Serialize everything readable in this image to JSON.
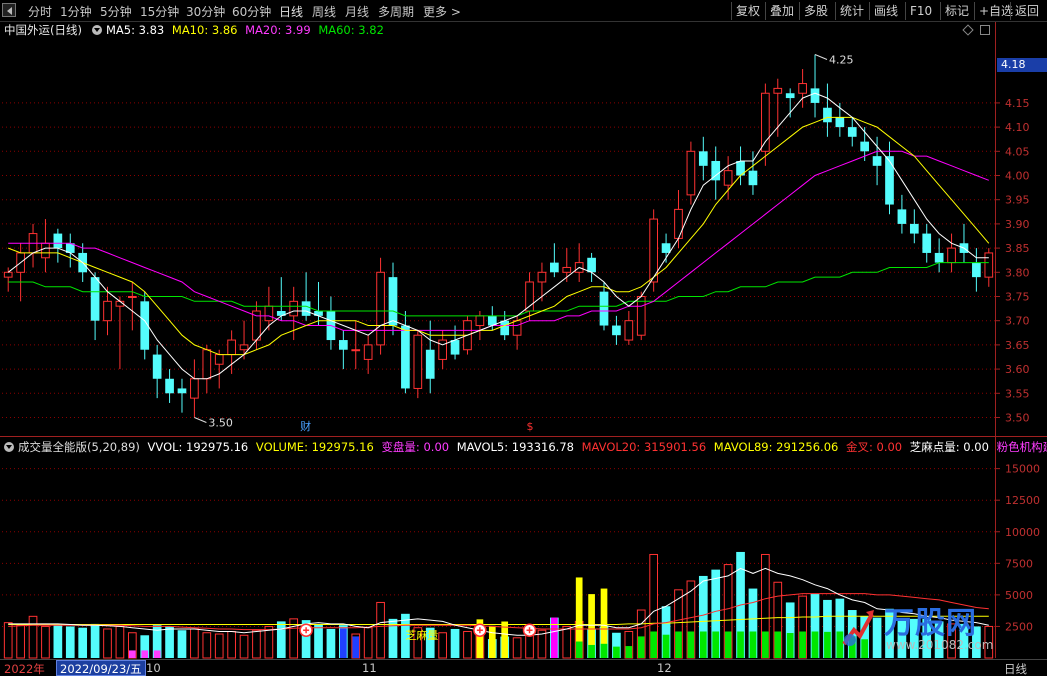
{
  "toolbar": {
    "left_items": [
      "分时",
      "1分钟",
      "5分钟",
      "15分钟",
      "30分钟",
      "60分钟",
      "日线",
      "周线",
      "月线",
      "多周期",
      "更多"
    ],
    "more_arrow": ">",
    "active_item": "日线",
    "right_items": [
      "复权",
      "叠加",
      "多股",
      "统计",
      "画线",
      "F10",
      "标记",
      "+自选",
      "返回"
    ]
  },
  "price_panel": {
    "stock_name": "中国外运(日线)",
    "ma5_label": "MA5: 3.83",
    "ma10_label": "MA10: 3.86",
    "ma20_label": "MA20: 3.99",
    "ma60_label": "MA60: 3.82",
    "current_price_tag": "4.18",
    "high_marker": "4.25",
    "low_marker": "3.50",
    "event_marker_cai": "财",
    "event_marker_dollar": "$",
    "colors": {
      "up": "#ff3232",
      "down": "#54fcfc",
      "ma5": "#ffffff",
      "ma10": "#ffff00",
      "ma20": "#ff00ff",
      "ma60": "#00e600"
    }
  },
  "volume_panel": {
    "indicator_name": "成交量全能版(5,20,89)",
    "vvol": "VVOL: 192975.16",
    "volume": "VOLUME: 192975.16",
    "bianpan": "变盘量: 0.00",
    "mavol5": "MAVOL5: 193316.78",
    "mavol20": "MAVOL20: 315901.56",
    "mavol89": "MAVOL89: 291256.06",
    "jincha": "金叉: 0.00",
    "zhima": "芝麻点量: 0.00",
    "fense": "粉色机构建",
    "inline_annotation": "芝麻量"
  },
  "date_bar": {
    "year": "2022年",
    "current_date": "2022/09/23/五",
    "months": [
      "10",
      "11",
      "12"
    ],
    "period": "日线"
  },
  "watermark": {
    "text": "万股网",
    "url": "www.201082.com"
  },
  "chart_data": [
    {
      "type": "candlestick",
      "title": "中国外运(日线)",
      "y_ticks": [
        3.5,
        3.55,
        3.6,
        3.65,
        3.7,
        3.75,
        3.8,
        3.85,
        3.9,
        3.95,
        4.0,
        4.05,
        4.1,
        4.15
      ],
      "ylim": [
        3.47,
        4.28
      ],
      "candles": [
        [
          3.79,
          3.81,
          3.76,
          3.8
        ],
        [
          3.8,
          3.86,
          3.74,
          3.84
        ],
        [
          3.84,
          3.9,
          3.81,
          3.88
        ],
        [
          3.83,
          3.91,
          3.8,
          3.86
        ],
        [
          3.88,
          3.89,
          3.82,
          3.85
        ],
        [
          3.86,
          3.88,
          3.81,
          3.84
        ],
        [
          3.84,
          3.86,
          3.78,
          3.8
        ],
        [
          3.79,
          3.8,
          3.66,
          3.7
        ],
        [
          3.7,
          3.77,
          3.67,
          3.74
        ],
        [
          3.73,
          3.75,
          3.6,
          3.74
        ],
        [
          3.75,
          3.78,
          3.68,
          3.75
        ],
        [
          3.74,
          3.76,
          3.62,
          3.64
        ],
        [
          3.63,
          3.65,
          3.54,
          3.58
        ],
        [
          3.58,
          3.6,
          3.53,
          3.55
        ],
        [
          3.56,
          3.58,
          3.51,
          3.55
        ],
        [
          3.54,
          3.62,
          3.5,
          3.58
        ],
        [
          3.58,
          3.65,
          3.55,
          3.64
        ],
        [
          3.61,
          3.64,
          3.56,
          3.63
        ],
        [
          3.63,
          3.68,
          3.59,
          3.66
        ],
        [
          3.64,
          3.7,
          3.62,
          3.65
        ],
        [
          3.66,
          3.74,
          3.64,
          3.72
        ],
        [
          3.7,
          3.77,
          3.68,
          3.73
        ],
        [
          3.72,
          3.79,
          3.7,
          3.71
        ],
        [
          3.71,
          3.77,
          3.66,
          3.74
        ],
        [
          3.74,
          3.8,
          3.7,
          3.71
        ],
        [
          3.72,
          3.78,
          3.69,
          3.71
        ],
        [
          3.72,
          3.75,
          3.64,
          3.66
        ],
        [
          3.66,
          3.68,
          3.6,
          3.64
        ],
        [
          3.64,
          3.7,
          3.6,
          3.64
        ],
        [
          3.62,
          3.67,
          3.59,
          3.65
        ],
        [
          3.65,
          3.83,
          3.63,
          3.8
        ],
        [
          3.79,
          3.82,
          3.67,
          3.69
        ],
        [
          3.69,
          3.72,
          3.55,
          3.56
        ],
        [
          3.56,
          3.68,
          3.54,
          3.67
        ],
        [
          3.64,
          3.7,
          3.55,
          3.58
        ],
        [
          3.62,
          3.68,
          3.6,
          3.66
        ],
        [
          3.66,
          3.69,
          3.62,
          3.63
        ],
        [
          3.64,
          3.71,
          3.63,
          3.7
        ],
        [
          3.69,
          3.72,
          3.66,
          3.71
        ],
        [
          3.71,
          3.73,
          3.68,
          3.69
        ],
        [
          3.7,
          3.72,
          3.66,
          3.67
        ],
        [
          3.67,
          3.71,
          3.64,
          3.7
        ],
        [
          3.72,
          3.8,
          3.7,
          3.78
        ],
        [
          3.78,
          3.82,
          3.74,
          3.8
        ],
        [
          3.82,
          3.86,
          3.79,
          3.8
        ],
        [
          3.8,
          3.85,
          3.78,
          3.81
        ],
        [
          3.8,
          3.86,
          3.78,
          3.82
        ],
        [
          3.83,
          3.84,
          3.78,
          3.8
        ],
        [
          3.76,
          3.78,
          3.68,
          3.69
        ],
        [
          3.69,
          3.71,
          3.65,
          3.67
        ],
        [
          3.66,
          3.72,
          3.65,
          3.7
        ],
        [
          3.67,
          3.76,
          3.66,
          3.75
        ],
        [
          3.78,
          3.93,
          3.76,
          3.91
        ],
        [
          3.86,
          3.88,
          3.82,
          3.84
        ],
        [
          3.87,
          3.97,
          3.85,
          3.93
        ],
        [
          3.96,
          4.07,
          3.94,
          4.05
        ],
        [
          4.05,
          4.08,
          3.99,
          4.02
        ],
        [
          4.03,
          4.06,
          3.95,
          3.99
        ],
        [
          3.98,
          4.04,
          3.95,
          4.01
        ],
        [
          4.03,
          4.06,
          3.98,
          4.0
        ],
        [
          4.01,
          4.05,
          3.96,
          3.98
        ],
        [
          4.05,
          4.19,
          4.02,
          4.17
        ],
        [
          4.17,
          4.2,
          4.08,
          4.18
        ],
        [
          4.17,
          4.18,
          4.12,
          4.16
        ],
        [
          4.17,
          4.22,
          4.14,
          4.19
        ],
        [
          4.18,
          4.25,
          4.12,
          4.15
        ],
        [
          4.14,
          4.19,
          4.08,
          4.11
        ],
        [
          4.12,
          4.15,
          4.08,
          4.1
        ],
        [
          4.1,
          4.12,
          4.06,
          4.08
        ],
        [
          4.07,
          4.1,
          4.03,
          4.05
        ],
        [
          4.04,
          4.08,
          3.98,
          4.02
        ],
        [
          4.04,
          4.07,
          3.92,
          3.94
        ],
        [
          3.93,
          3.96,
          3.88,
          3.9
        ],
        [
          3.9,
          3.93,
          3.86,
          3.88
        ],
        [
          3.88,
          3.9,
          3.82,
          3.84
        ],
        [
          3.84,
          3.87,
          3.8,
          3.82
        ],
        [
          3.82,
          3.88,
          3.8,
          3.85
        ],
        [
          3.86,
          3.9,
          3.82,
          3.84
        ],
        [
          3.82,
          3.85,
          3.76,
          3.79
        ],
        [
          3.79,
          3.85,
          3.77,
          3.84
        ]
      ],
      "ma5": [
        3.8,
        3.82,
        3.84,
        3.85,
        3.85,
        3.84,
        3.82,
        3.79,
        3.76,
        3.74,
        3.72,
        3.7,
        3.66,
        3.63,
        3.6,
        3.58,
        3.58,
        3.59,
        3.61,
        3.63,
        3.66,
        3.69,
        3.71,
        3.72,
        3.72,
        3.71,
        3.7,
        3.69,
        3.68,
        3.67,
        3.69,
        3.7,
        3.69,
        3.68,
        3.66,
        3.65,
        3.66,
        3.67,
        3.68,
        3.69,
        3.7,
        3.71,
        3.73,
        3.75,
        3.77,
        3.79,
        3.81,
        3.8,
        3.78,
        3.75,
        3.73,
        3.75,
        3.79,
        3.83,
        3.87,
        3.93,
        3.98,
        4.0,
        4.02,
        4.03,
        4.03,
        4.07,
        4.1,
        4.13,
        4.16,
        4.17,
        4.16,
        4.14,
        4.12,
        4.09,
        4.06,
        4.03,
        3.99,
        3.95,
        3.91,
        3.88,
        3.86,
        3.85,
        3.83,
        3.83
      ],
      "ma10": [
        3.85,
        3.84,
        3.84,
        3.84,
        3.84,
        3.83,
        3.82,
        3.81,
        3.8,
        3.79,
        3.78,
        3.76,
        3.73,
        3.7,
        3.67,
        3.65,
        3.64,
        3.63,
        3.63,
        3.63,
        3.64,
        3.65,
        3.67,
        3.68,
        3.69,
        3.7,
        3.7,
        3.7,
        3.7,
        3.69,
        3.69,
        3.69,
        3.68,
        3.68,
        3.67,
        3.67,
        3.67,
        3.67,
        3.68,
        3.68,
        3.69,
        3.7,
        3.71,
        3.72,
        3.73,
        3.75,
        3.76,
        3.77,
        3.77,
        3.76,
        3.76,
        3.77,
        3.79,
        3.81,
        3.84,
        3.87,
        3.9,
        3.94,
        3.97,
        4.0,
        4.02,
        4.04,
        4.06,
        4.08,
        4.1,
        4.11,
        4.12,
        4.12,
        4.12,
        4.11,
        4.1,
        4.08,
        4.06,
        4.04,
        4.01,
        3.98,
        3.95,
        3.92,
        3.89,
        3.86
      ],
      "ma20": [
        3.86,
        3.86,
        3.86,
        3.86,
        3.86,
        3.86,
        3.85,
        3.85,
        3.84,
        3.83,
        3.82,
        3.81,
        3.8,
        3.79,
        3.78,
        3.76,
        3.75,
        3.74,
        3.73,
        3.72,
        3.71,
        3.71,
        3.7,
        3.7,
        3.69,
        3.69,
        3.69,
        3.68,
        3.68,
        3.68,
        3.68,
        3.68,
        3.68,
        3.68,
        3.68,
        3.68,
        3.68,
        3.68,
        3.68,
        3.69,
        3.69,
        3.69,
        3.7,
        3.7,
        3.7,
        3.71,
        3.71,
        3.72,
        3.72,
        3.72,
        3.73,
        3.73,
        3.74,
        3.76,
        3.78,
        3.8,
        3.82,
        3.84,
        3.86,
        3.88,
        3.9,
        3.92,
        3.94,
        3.96,
        3.98,
        4.0,
        4.01,
        4.02,
        4.03,
        4.04,
        4.05,
        4.05,
        4.05,
        4.04,
        4.04,
        4.03,
        4.02,
        4.01,
        4.0,
        3.99
      ],
      "ma60": [
        3.78,
        3.78,
        3.78,
        3.77,
        3.77,
        3.77,
        3.76,
        3.76,
        3.76,
        3.76,
        3.76,
        3.75,
        3.75,
        3.75,
        3.75,
        3.74,
        3.74,
        3.74,
        3.74,
        3.73,
        3.73,
        3.73,
        3.73,
        3.73,
        3.73,
        3.72,
        3.72,
        3.72,
        3.72,
        3.72,
        3.72,
        3.72,
        3.71,
        3.71,
        3.71,
        3.71,
        3.71,
        3.71,
        3.71,
        3.71,
        3.71,
        3.71,
        3.72,
        3.72,
        3.72,
        3.72,
        3.73,
        3.73,
        3.73,
        3.73,
        3.74,
        3.74,
        3.74,
        3.74,
        3.75,
        3.75,
        3.75,
        3.76,
        3.76,
        3.77,
        3.77,
        3.77,
        3.78,
        3.78,
        3.78,
        3.79,
        3.79,
        3.79,
        3.8,
        3.8,
        3.8,
        3.81,
        3.81,
        3.81,
        3.81,
        3.82,
        3.82,
        3.82,
        3.82,
        3.82
      ]
    },
    {
      "type": "bar",
      "title": "成交量全能版(5,20,89)",
      "y_ticks": [
        2500,
        5000,
        7500,
        10000,
        12500,
        15000
      ],
      "ylim": [
        0,
        16000
      ],
      "volumes": [
        2800,
        2600,
        3300,
        2500,
        2700,
        2500,
        2400,
        2700,
        2300,
        2500,
        2000,
        1800,
        2600,
        2500,
        2200,
        2300,
        2000,
        1900,
        2100,
        1800,
        2200,
        2500,
        2900,
        3100,
        3000,
        2700,
        2300,
        2600,
        1900,
        2400,
        4400,
        3100,
        3500,
        2400,
        2400,
        2000,
        2300,
        2100,
        1800,
        1500,
        1700,
        1600,
        2200,
        2200,
        3200,
        2500,
        2900,
        2300,
        2500,
        2000,
        2100,
        3800,
        8200,
        4100,
        5400,
        6100,
        6500,
        7000,
        7400,
        8400,
        5500,
        8200,
        6000,
        4400,
        4900,
        5100,
        4600,
        4700,
        3800,
        3300,
        3200,
        3900,
        3000,
        3100,
        3100,
        2900,
        2700,
        2700,
        2500,
        2500
      ],
      "mavol5": [
        2700,
        2700,
        2700,
        2700,
        2700,
        2650,
        2600,
        2600,
        2550,
        2500,
        2400,
        2300,
        2200,
        2300,
        2300,
        2300,
        2200,
        2100,
        2100,
        2000,
        2100,
        2200,
        2300,
        2500,
        2700,
        2800,
        2700,
        2700,
        2500,
        2400,
        2800,
        2900,
        3000,
        3100,
        3000,
        2900,
        2600,
        2400,
        2200,
        2000,
        1900,
        1800,
        1800,
        1900,
        2100,
        2300,
        2600,
        2600,
        2600,
        2400,
        2400,
        2700,
        3700,
        4100,
        4700,
        5300,
        6100,
        6300,
        6500,
        7100,
        6700,
        7100,
        6700,
        6500,
        6200,
        5800,
        5500,
        5000,
        4600,
        4400,
        3900,
        3800,
        3600,
        3500,
        3300,
        3200,
        3000,
        2900,
        2800,
        2600
      ],
      "mavol20": [
        2500,
        2550,
        2600,
        2600,
        2600,
        2600,
        2600,
        2600,
        2600,
        2600,
        2550,
        2500,
        2500,
        2500,
        2450,
        2400,
        2350,
        2300,
        2300,
        2250,
        2250,
        2250,
        2300,
        2350,
        2400,
        2400,
        2400,
        2400,
        2400,
        2450,
        2500,
        2550,
        2600,
        2600,
        2600,
        2600,
        2600,
        2600,
        2550,
        2500,
        2450,
        2400,
        2350,
        2300,
        2300,
        2300,
        2300,
        2300,
        2300,
        2300,
        2300,
        2400,
        2700,
        2800,
        3000,
        3200,
        3400,
        3700,
        3900,
        4200,
        4400,
        4700,
        4900,
        5000,
        5100,
        5100,
        5100,
        5100,
        5100,
        5100,
        5000,
        5000,
        4900,
        4800,
        4700,
        4600,
        4400,
        4200,
        4000,
        3900
      ],
      "mavol89": [
        2650,
        2650,
        2650,
        2650,
        2650,
        2650,
        2650,
        2650,
        2650,
        2650,
        2650,
        2650,
        2650,
        2650,
        2650,
        2650,
        2650,
        2650,
        2650,
        2650,
        2650,
        2650,
        2650,
        2650,
        2650,
        2650,
        2650,
        2650,
        2650,
        2650,
        2650,
        2650,
        2650,
        2650,
        2650,
        2650,
        2650,
        2650,
        2650,
        2650,
        2650,
        2650,
        2650,
        2650,
        2650,
        2650,
        2650,
        2650,
        2650,
        2650,
        2700,
        2700,
        2750,
        2750,
        2800,
        2850,
        2900,
        2950,
        3000,
        3050,
        3100,
        3150,
        3200,
        3200,
        3250,
        3250,
        3300,
        3300,
        3300,
        3300,
        3300,
        3300,
        3300,
        3300,
        3300,
        3300,
        3300,
        3300,
        3300,
        3300
      ]
    }
  ]
}
